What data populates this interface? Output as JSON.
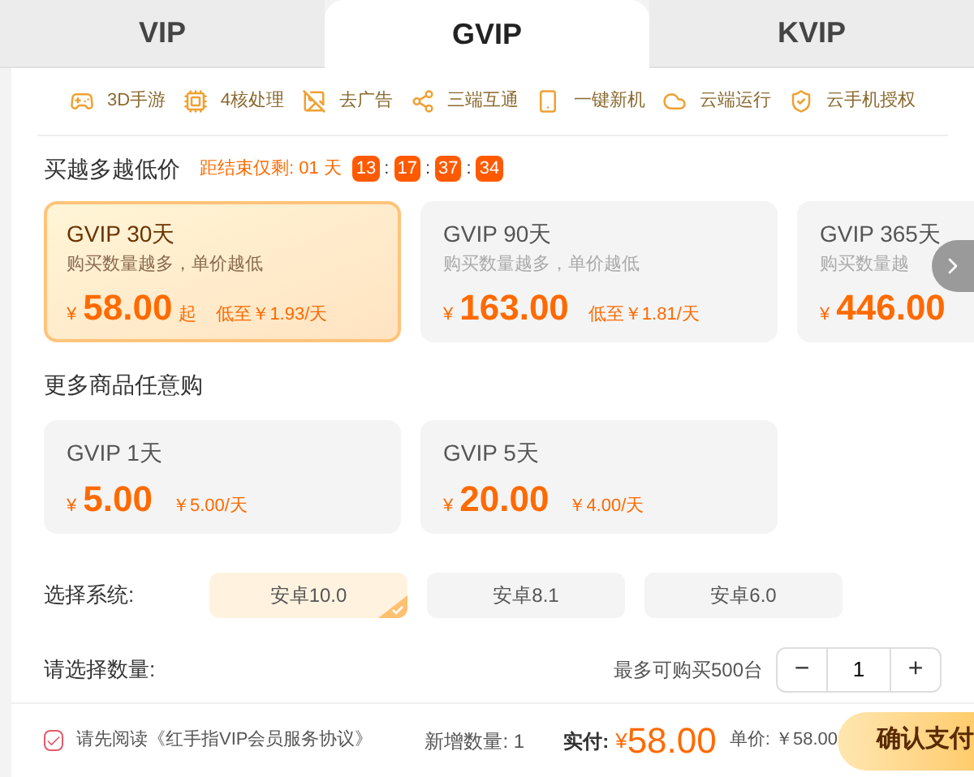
{
  "tabs": [
    {
      "label": "VIP",
      "selected": false
    },
    {
      "label": "GVIP",
      "selected": true
    },
    {
      "label": "KVIP",
      "selected": false
    }
  ],
  "features": [
    "3D手游",
    "4核处理",
    "去广告",
    "三端互通",
    "一键新机",
    "云端运行",
    "云手机授权"
  ],
  "promo": {
    "title": "买越多越低价",
    "countdown_label": "距结束仅剩: 01 天",
    "countdown": [
      {
        "kind": "box",
        "text": "13"
      },
      {
        "kind": "sep",
        "text": ":"
      },
      {
        "kind": "box",
        "text": "17"
      },
      {
        "kind": "sep",
        "text": ":"
      },
      {
        "kind": "box",
        "text": "37"
      },
      {
        "kind": "sep",
        "text": ":"
      },
      {
        "kind": "box",
        "text": "34"
      }
    ]
  },
  "plans": [
    {
      "title": "GVIP 30天",
      "subtitle": "购买数量越多，单价越低",
      "currency": "¥",
      "price": "58.00",
      "suffix": "起",
      "unit_price": "低至￥1.93/天",
      "selected": true
    },
    {
      "title": "GVIP 90天",
      "subtitle": "购买数量越多，单价越低",
      "currency": "¥",
      "price": "163.00",
      "unit_price": "低至￥1.81/天",
      "selected": false
    },
    {
      "title": "GVIP 365天",
      "subtitle": "购买数量越",
      "currency": "¥",
      "price": "446.00",
      "selected": false
    }
  ],
  "more": {
    "title": "更多商品任意购",
    "items": [
      {
        "title": "GVIP 1天",
        "currency": "¥",
        "price": "5.00",
        "unit_price": "￥5.00/天",
        "selected": false
      },
      {
        "title": "GVIP 5天",
        "currency": "¥",
        "price": "20.00",
        "unit_price": "￥4.00/天",
        "selected": false
      }
    ]
  },
  "system": {
    "label": "选择系统:",
    "options": [
      {
        "label": "安卓10.0",
        "selected": true
      },
      {
        "label": "安卓8.1",
        "selected": false
      },
      {
        "label": "安卓6.0",
        "selected": false
      }
    ]
  },
  "quantity": {
    "label": "请选择数量:",
    "limit": "最多可购买500台",
    "minus": "−",
    "value": "1",
    "plus": "+"
  },
  "footer": {
    "agree_checked": true,
    "agreement": "请先阅读《红手指VIP会员服务协议》",
    "added": "新增数量: 1",
    "paid_label": "实付:",
    "paid_currency": "¥",
    "paid": "58.00",
    "unit": "单价: ￥58.00",
    "confirm": "确认支付"
  }
}
